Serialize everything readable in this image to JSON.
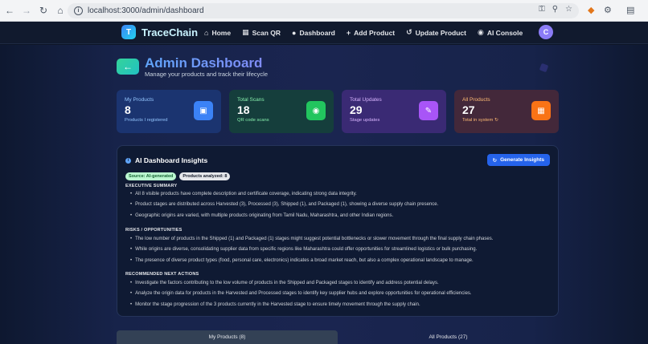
{
  "browser": {
    "url": "localhost:3000/admin/dashboard"
  },
  "nav": {
    "brand_initial": "T",
    "brand_name": "TraceChain",
    "links": [
      {
        "label": "Home",
        "icon": "home-icon"
      },
      {
        "label": "Scan QR",
        "icon": "qr-icon"
      },
      {
        "label": "Dashboard",
        "icon": "user-icon"
      },
      {
        "label": "Add Product",
        "icon": "plus-icon"
      },
      {
        "label": "Update Product",
        "icon": "history-icon"
      },
      {
        "label": "AI Console",
        "icon": "robot-icon"
      }
    ],
    "avatar_initial": "C"
  },
  "header": {
    "title": "Admin Dashboard",
    "subtitle": "Manage your products and track their lifecycle"
  },
  "stats": [
    {
      "label": "My Products",
      "value": "8",
      "sub": "Products I registered",
      "icon": "box-icon"
    },
    {
      "label": "Total Scans",
      "value": "18",
      "sub": "QR code scans",
      "icon": "eye-icon"
    },
    {
      "label": "Total Updates",
      "value": "29",
      "sub": "Stage updates",
      "icon": "edit-icon"
    },
    {
      "label": "All Products",
      "value": "27",
      "sub": "Total in system",
      "icon": "grid-icon"
    }
  ],
  "insights": {
    "title": "AI Dashboard Insights",
    "generate_label": "Generate Insights",
    "badge_source": "Source: AI-generated",
    "badge_count": "Products analyzed: 8",
    "sections": [
      {
        "heading": "EXECUTIVE SUMMARY",
        "items": [
          "All 8 visible products have complete description and certificate coverage, indicating strong data integrity.",
          "Product stages are distributed across Harvested (3), Processed (3), Shipped (1), and Packaged (1), showing a diverse supply chain presence.",
          "Geographic origins are varied, with multiple products originating from Tamil Nadu, Maharashtra, and other Indian regions."
        ]
      },
      {
        "heading": "RISKS / OPPORTUNITIES",
        "items": [
          "The low number of products in the Shipped (1) and Packaged (1) stages might suggest potential bottlenecks or slower movement through the final supply chain phases.",
          "While origins are diverse, consolidating supplier data from specific regions like Maharashtra could offer opportunities for streamlined logistics or bulk purchasing.",
          "The presence of diverse product types (food, personal care, electronics) indicates a broad market reach, but also a complex operational landscape to manage."
        ]
      },
      {
        "heading": "RECOMMENDED NEXT ACTIONS",
        "items": [
          "Investigate the factors contributing to the low volume of products in the Shipped and Packaged stages to identify and address potential delays.",
          "Analyze the origin data for products in the Harvested and Processed stages to identify key supplier hubs and explore opportunities for operational efficiencies.",
          "Monitor the stage progression of the 3 products currently in the Harvested stage to ensure timely movement through the supply chain."
        ]
      }
    ]
  },
  "tabs": [
    {
      "label": "My Products (8)",
      "active": true
    },
    {
      "label": "All Products (27)",
      "active": false
    }
  ]
}
